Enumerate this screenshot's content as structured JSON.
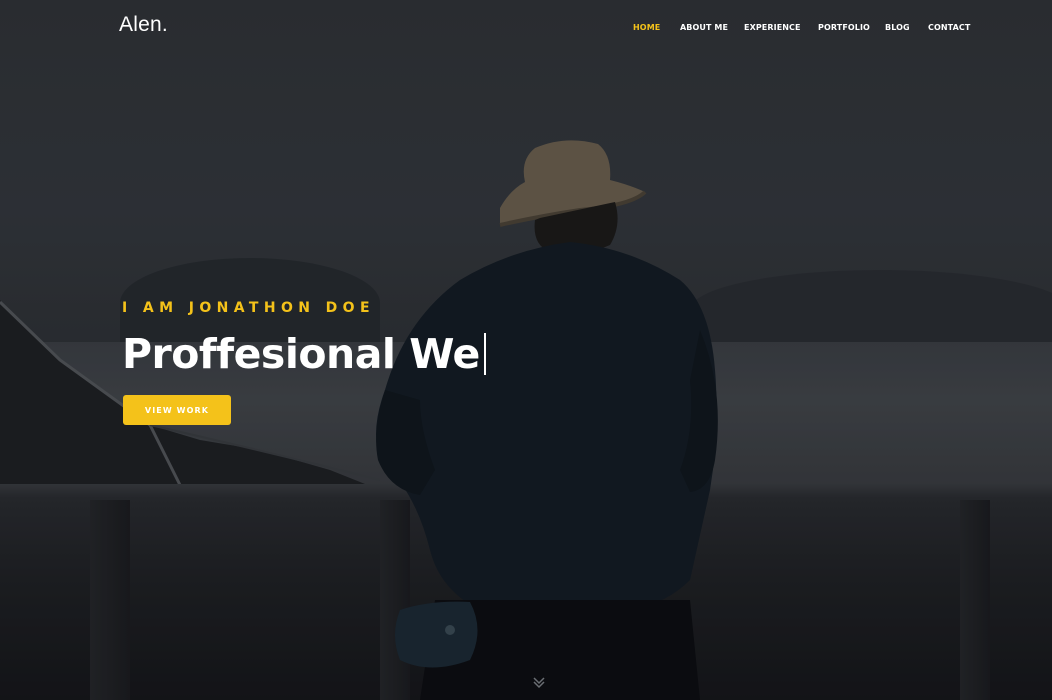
{
  "header": {
    "logo": "Alen.",
    "nav": [
      {
        "label": "HOME",
        "active": true
      },
      {
        "label": "ABOUT ME",
        "active": false
      },
      {
        "label": "EXPERIENCE",
        "active": false
      },
      {
        "label": "PORTFOLIO",
        "active": false
      },
      {
        "label": "BLOG",
        "active": false
      },
      {
        "label": "CONTACT",
        "active": false
      }
    ]
  },
  "hero": {
    "kicker": "I AM JONATHON DOE",
    "headline": "Proffesional We",
    "cta_label": "VIEW WORK"
  },
  "colors": {
    "accent": "#f4c21a",
    "text": "#ffffff"
  },
  "icons": {
    "scroll_down": "chevron-down-icon"
  }
}
